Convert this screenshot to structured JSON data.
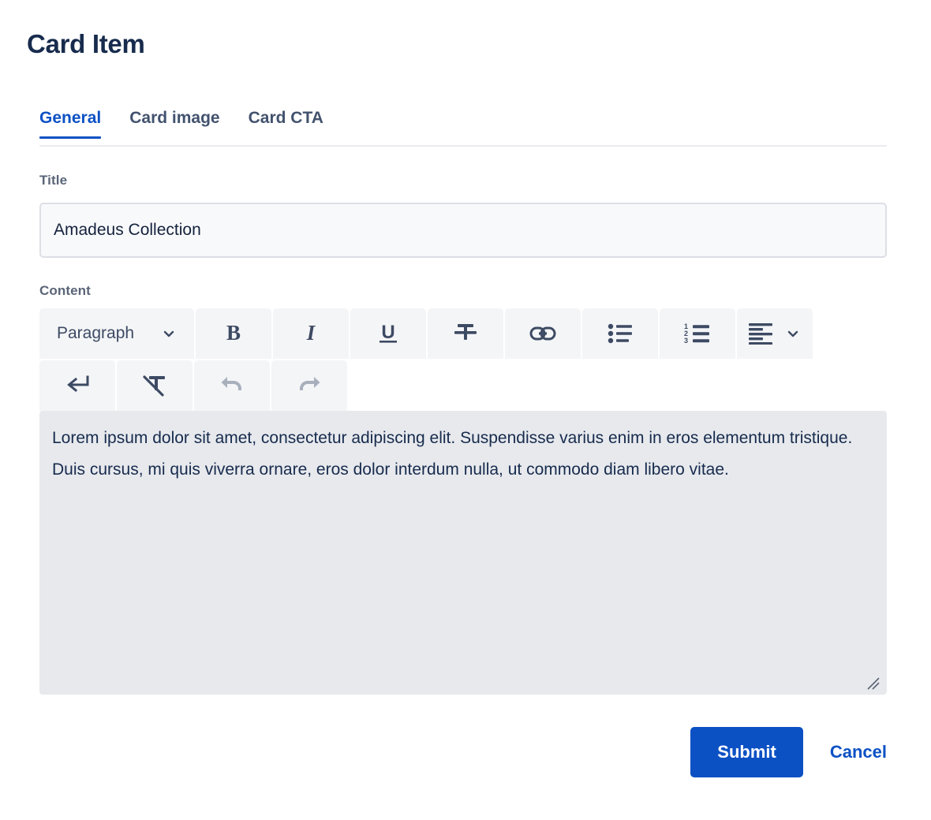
{
  "page_title": "Card Item",
  "colors": {
    "accent": "#0c51c4",
    "title_text": "#172b4d",
    "label_text": "#5a6577",
    "toolbar_bg": "#f4f5f7",
    "textarea_bg": "#e7e9ed",
    "input_bg": "#f8f9fb",
    "input_border": "#dcdfe4",
    "icon": "#3d4a63",
    "icon_disabled": "#a9b0bd"
  },
  "tabs": [
    {
      "label": "General",
      "active": true
    },
    {
      "label": "Card image",
      "active": false
    },
    {
      "label": "Card CTA",
      "active": false
    }
  ],
  "fields": {
    "title": {
      "label": "Title",
      "value": "Amadeus Collection",
      "placeholder": ""
    },
    "content": {
      "label": "Content",
      "value": "Lorem ipsum dolor sit amet, consectetur adipiscing elit. Suspendisse varius enim in eros elementum tristique. Duis cursus, mi quis viverra ornare, eros dolor interdum nulla, ut commodo diam libero vitae.",
      "placeholder": ""
    }
  },
  "toolbar": {
    "row1": [
      {
        "id": "paragraph",
        "icon": "paragraph-style-dropdown",
        "label": "Paragraph",
        "has_chevron": true,
        "disabled": false
      },
      {
        "id": "bold",
        "icon": "bold-icon",
        "label": "B",
        "has_chevron": false,
        "disabled": false
      },
      {
        "id": "italic",
        "icon": "italic-icon",
        "label": "I",
        "has_chevron": false,
        "disabled": false
      },
      {
        "id": "underline",
        "icon": "underline-icon",
        "label": "U",
        "has_chevron": false,
        "disabled": false
      },
      {
        "id": "strikethrough",
        "icon": "strikethrough-icon",
        "label": "",
        "has_chevron": false,
        "disabled": false
      },
      {
        "id": "link",
        "icon": "link-icon",
        "label": "",
        "has_chevron": false,
        "disabled": false
      },
      {
        "id": "bullet-list",
        "icon": "bullet-list-icon",
        "label": "",
        "has_chevron": false,
        "disabled": false
      },
      {
        "id": "numbered-list",
        "icon": "numbered-list-icon",
        "label": "",
        "has_chevron": false,
        "disabled": false
      },
      {
        "id": "align",
        "icon": "align-left-icon",
        "label": "",
        "has_chevron": true,
        "disabled": false
      }
    ],
    "row2": [
      {
        "id": "line-break",
        "icon": "line-break-icon",
        "label": "",
        "has_chevron": false,
        "disabled": false
      },
      {
        "id": "clear-formatting",
        "icon": "clear-formatting-icon",
        "label": "",
        "has_chevron": false,
        "disabled": false
      },
      {
        "id": "undo",
        "icon": "undo-icon",
        "label": "",
        "has_chevron": false,
        "disabled": true
      },
      {
        "id": "redo",
        "icon": "redo-icon",
        "label": "",
        "has_chevron": false,
        "disabled": true
      }
    ]
  },
  "actions": {
    "submit_label": "Submit",
    "cancel_label": "Cancel"
  }
}
